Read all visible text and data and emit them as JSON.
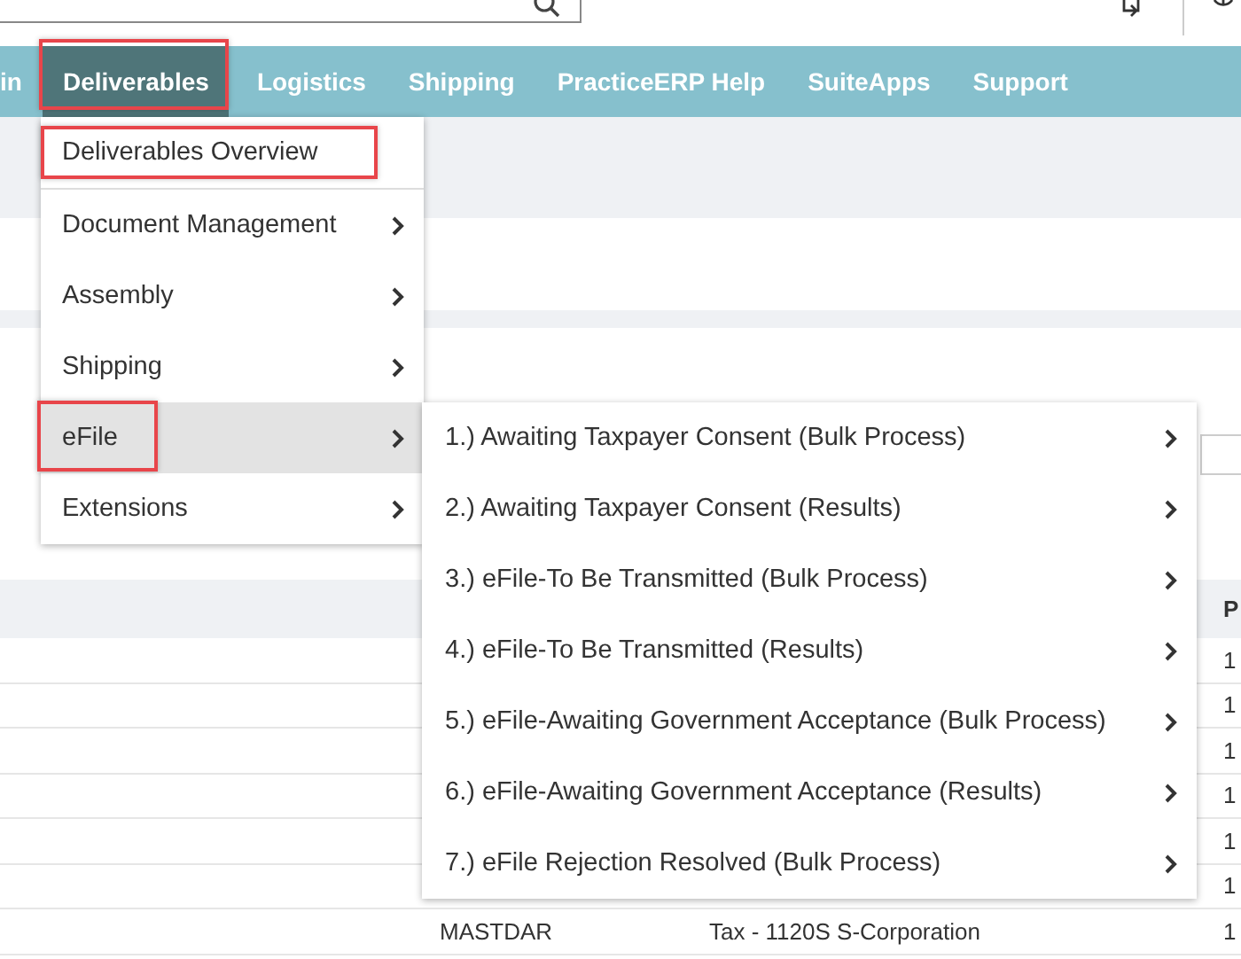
{
  "nav": {
    "items": [
      {
        "label": "in",
        "selected": false,
        "highlighted": false
      },
      {
        "label": "Deliverables",
        "selected": true,
        "highlighted": true
      },
      {
        "label": "Logistics",
        "selected": false,
        "highlighted": false
      },
      {
        "label": "Shipping",
        "selected": false,
        "highlighted": false
      },
      {
        "label": "PracticeERP Help",
        "selected": false,
        "highlighted": false
      },
      {
        "label": "SuiteApps",
        "selected": false,
        "highlighted": false
      },
      {
        "label": "Support",
        "selected": false,
        "highlighted": false
      }
    ]
  },
  "menu": {
    "items": [
      {
        "label": "Deliverables Overview",
        "has_submenu": false,
        "selected": false,
        "highlighted": true
      },
      {
        "label": "Document Management",
        "has_submenu": true,
        "selected": false,
        "highlighted": false
      },
      {
        "label": "Assembly",
        "has_submenu": true,
        "selected": false,
        "highlighted": false
      },
      {
        "label": "Shipping",
        "has_submenu": true,
        "selected": false,
        "highlighted": false
      },
      {
        "label": "eFile",
        "has_submenu": true,
        "selected": true,
        "highlighted": true
      },
      {
        "label": "Extensions",
        "has_submenu": true,
        "selected": false,
        "highlighted": false
      }
    ]
  },
  "submenu": {
    "items": [
      {
        "label": "1.) Awaiting Taxpayer Consent (Bulk Process)",
        "has_submenu": true
      },
      {
        "label": "2.) Awaiting Taxpayer Consent (Results)",
        "has_submenu": true
      },
      {
        "label": "3.) eFile-To Be Transmitted (Bulk Process)",
        "has_submenu": true
      },
      {
        "label": "4.) eFile-To Be Transmitted (Results)",
        "has_submenu": true
      },
      {
        "label": "5.) eFile-Awaiting Government Acceptance (Bulk Process)",
        "has_submenu": true
      },
      {
        "label": "6.) eFile-Awaiting Government Acceptance (Results)",
        "has_submenu": true
      },
      {
        "label": "7.) eFile Rejection Resolved (Bulk Process)",
        "has_submenu": true
      }
    ]
  },
  "table": {
    "columns": {
      "column_4": "P"
    },
    "rows": [
      {
        "column_4": "1"
      },
      {
        "column_4": "1"
      },
      {
        "column_4": "1"
      },
      {
        "column_4": "1"
      },
      {
        "column_4": "1"
      },
      {
        "column_4": "1"
      },
      {
        "column_2": "MASTDAR",
        "column_3": "Tax - 1120S S-Corporation",
        "column_4": "1"
      }
    ]
  }
}
